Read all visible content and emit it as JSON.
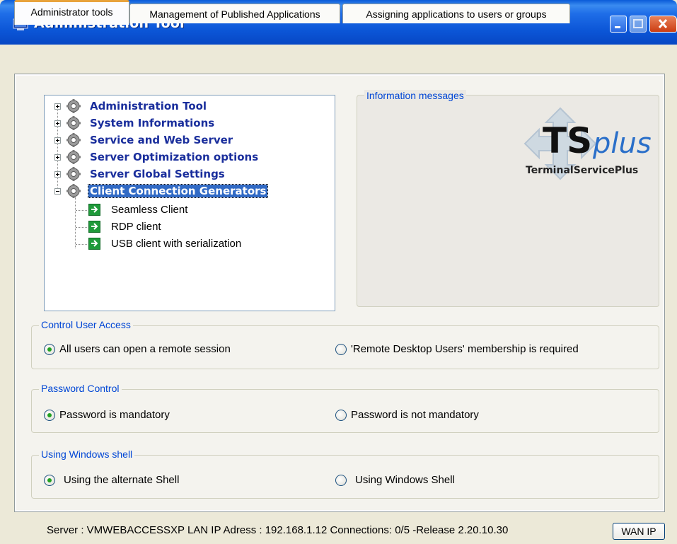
{
  "window": {
    "title": "Administration Tool",
    "colors": {
      "titlebar": "#0b55d6",
      "face": "#ece9d8",
      "tree_text": "#1a2e9c",
      "selection": "#316ac5",
      "group_label": "#0046d5",
      "check": "#21a121"
    }
  },
  "tabs": [
    {
      "label": "Administrator tools",
      "active": true
    },
    {
      "label": "Management of Published Applications",
      "active": false
    },
    {
      "label": "Assigning applications to users or groups",
      "active": false
    }
  ],
  "tree": {
    "items": [
      {
        "label": "Administration Tool",
        "icon": "gear-icon",
        "expanded": false
      },
      {
        "label": "System Informations",
        "icon": "gear-icon",
        "expanded": false
      },
      {
        "label": "Service and Web Server",
        "icon": "gear-icon",
        "expanded": false
      },
      {
        "label": "Server Optimization options",
        "icon": "gear-icon",
        "expanded": false
      },
      {
        "label": "Server Global Settings",
        "icon": "gear-icon",
        "expanded": false
      },
      {
        "label": "Client Connection Generators",
        "icon": "gear-icon",
        "expanded": true,
        "selected": true
      }
    ],
    "children": [
      {
        "label": "Seamless Client",
        "icon": "green-arrow-icon"
      },
      {
        "label": "RDP client",
        "icon": "green-arrow-icon"
      },
      {
        "label": "USB client with serialization",
        "icon": "green-arrow-icon"
      }
    ]
  },
  "info": {
    "legend": "Information messages",
    "logo_text_main": "TS",
    "logo_text_plus": "plus",
    "logo_caption": "TerminalServicePlus"
  },
  "control_access": {
    "legend": "Control User Access",
    "options": [
      {
        "label": "All users can open a remote session",
        "checked": true
      },
      {
        "label": "'Remote Desktop Users' membership is required",
        "checked": false
      }
    ]
  },
  "password_control": {
    "legend": "Password Control",
    "options": [
      {
        "label": "Password is mandatory",
        "checked": true
      },
      {
        "label": "Password is not mandatory",
        "checked": false
      }
    ]
  },
  "shell": {
    "legend": "Using Windows shell",
    "options": [
      {
        "label": "Using the alternate Shell",
        "checked": true
      },
      {
        "label": "Using Windows Shell",
        "checked": false
      }
    ]
  },
  "status": {
    "text": "Server : VMWEBACCESSXP LAN IP Adress : 192.168.1.12 Connections: 0/5  -Release 2.20.10.30",
    "wan_button": "WAN IP"
  }
}
